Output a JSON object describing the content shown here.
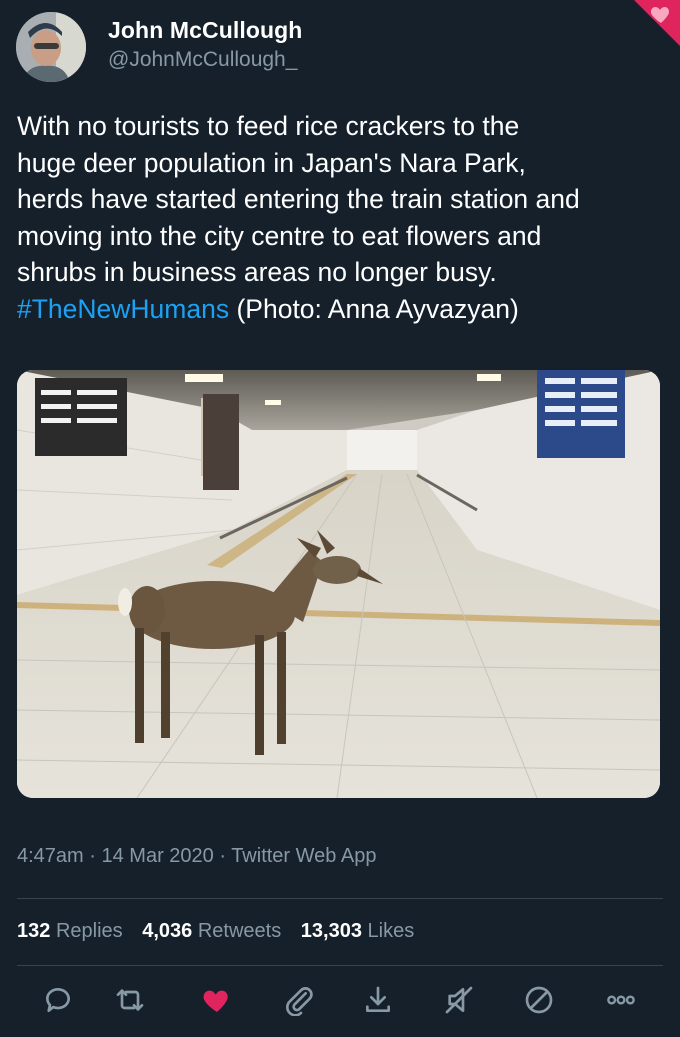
{
  "tweet": {
    "author": {
      "name": "John McCullough",
      "handle": "@JohnMcCullough_"
    },
    "text_lines": [
      "With no tourists to feed rice crackers to the",
      "huge deer population in Japan's Nara Park,",
      "herds have started entering the train station and",
      "moving into the city centre to eat flowers and",
      "shrubs in business areas no longer busy."
    ],
    "hashtag": "#TheNewHumans",
    "credit": "(Photo: Anna Ayvazyan)",
    "meta": "4:47am · 14 Mar 2020 · Twitter Web App",
    "stats": {
      "replies_count": "132",
      "replies_label": "Replies",
      "retweets_count": "4,036",
      "retweets_label": "Retweets",
      "likes_count": "13,303",
      "likes_label": "Likes"
    }
  },
  "actions": [
    {
      "icon": "reply-icon"
    },
    {
      "icon": "retweet-icon"
    },
    {
      "icon": "heart-icon",
      "active": true
    },
    {
      "icon": "paperclip-icon"
    },
    {
      "icon": "download-icon"
    },
    {
      "icon": "mute-icon"
    },
    {
      "icon": "block-icon"
    },
    {
      "icon": "more-icon"
    }
  ],
  "colors": {
    "background": "#15202b",
    "text": "#ffffff",
    "muted": "#8899a6",
    "link": "#1da1f2",
    "like": "#e0245e",
    "divider": "#38444d"
  }
}
